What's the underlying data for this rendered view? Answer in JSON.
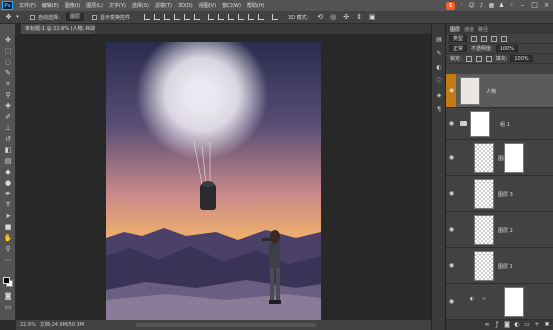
{
  "menubar": {
    "logo": "Ps",
    "items": [
      "文件(F)",
      "编辑(E)",
      "图像(I)",
      "图层(L)",
      "文字(Y)",
      "选择(S)",
      "滤镜(T)",
      "3D(D)",
      "视图(V)",
      "窗口(W)",
      "帮助(H)"
    ],
    "ime_label": "S"
  },
  "optionsbar": {
    "auto_select_label": "自动选择：",
    "auto_select_value": "图层",
    "transform_label": "显示变换控件",
    "mode_label": "3D 模式："
  },
  "document": {
    "tab_title": "未标题-1 @ 22.6% (人物, RGB/8) *",
    "zoom": "22.6%",
    "doc_size": "文档:24.9M/50.3M"
  },
  "layers_panel": {
    "tabs": [
      "图层",
      "通道",
      "路径"
    ],
    "kind_label": "类型",
    "blend_mode": "正常",
    "opacity_label": "不透明度:",
    "opacity": "100%",
    "lock_label": "锁定:",
    "fill_label": "填充:",
    "fill": "100%",
    "layers": [
      {
        "name": "人物",
        "selected": true
      },
      {
        "name": "组 1",
        "selected": false
      },
      {
        "name": "图层 4",
        "selected": false
      },
      {
        "name": "图层 3",
        "selected": false
      },
      {
        "name": "图层 2",
        "selected": false
      },
      {
        "name": "图层 1",
        "selected": false
      },
      {
        "name": "",
        "selected": false
      }
    ]
  },
  "colors": {
    "selected_layer_accent": "#c47a12",
    "ui_dark": "#424242",
    "ps_blue": "#31a8ff"
  }
}
